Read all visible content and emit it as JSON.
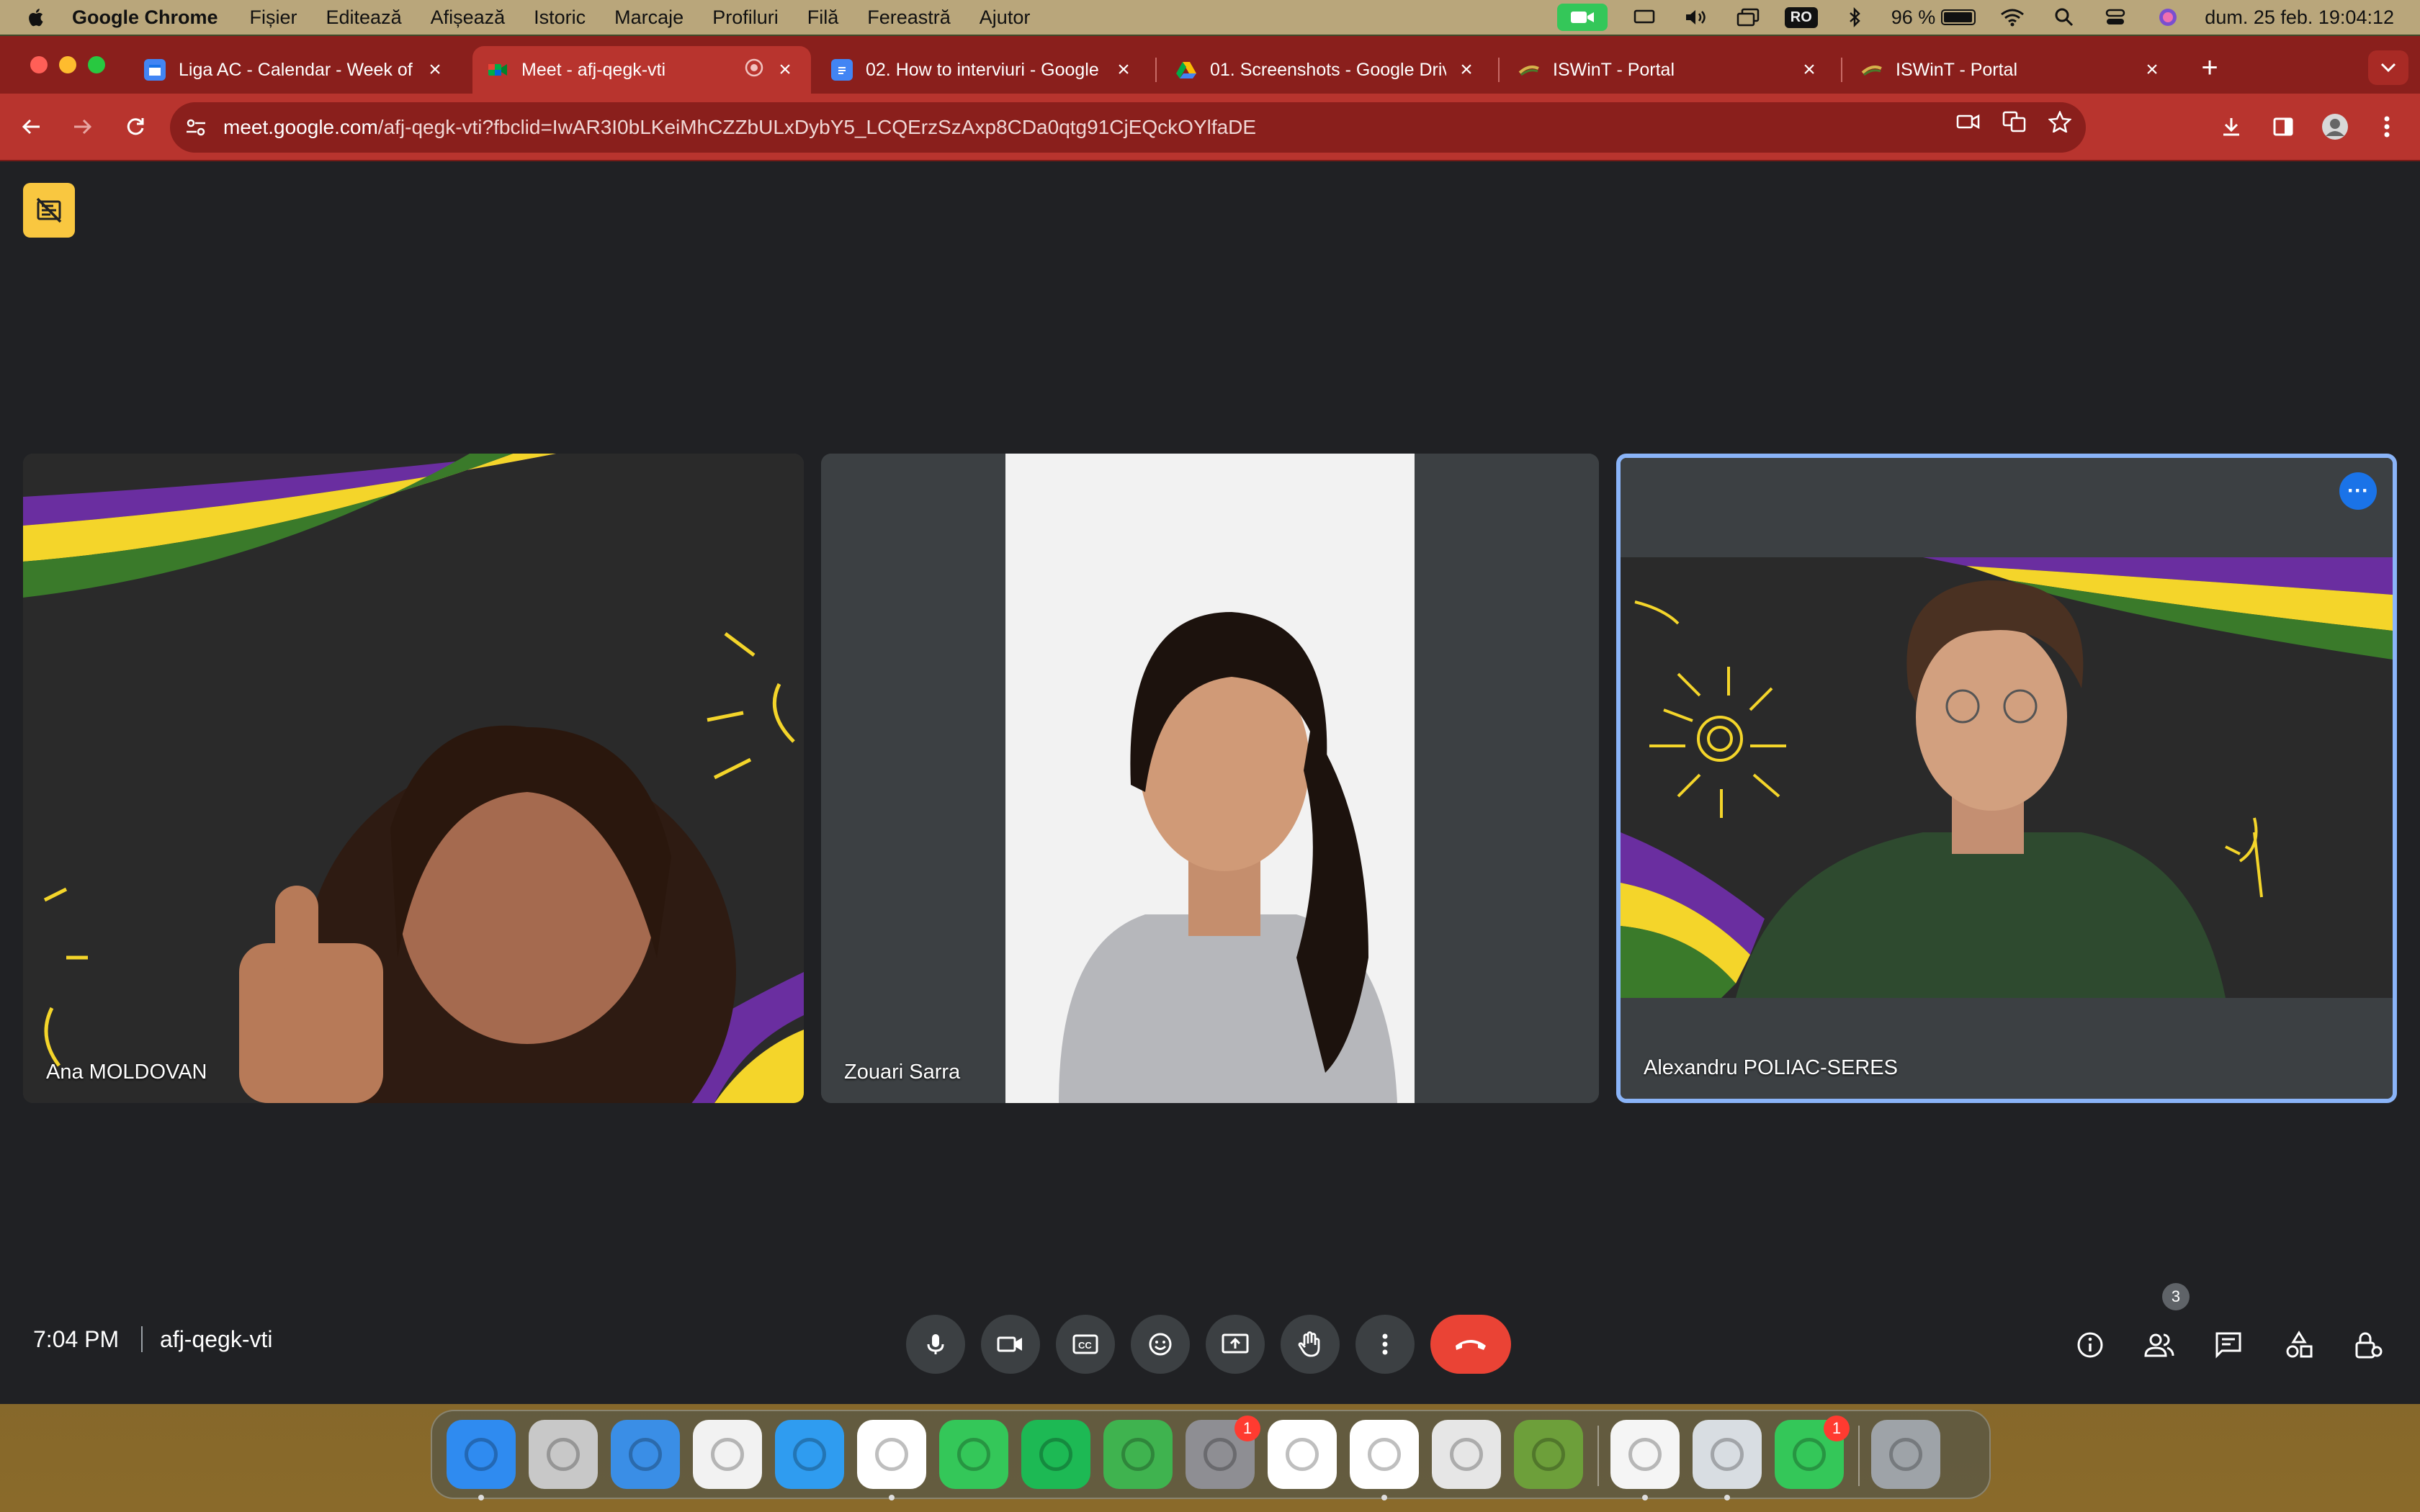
{
  "menubar": {
    "app_name": "Google Chrome",
    "menus": [
      "Fișier",
      "Editează",
      "Afișează",
      "Istoric",
      "Marcaje",
      "Profiluri",
      "Filă",
      "Fereastră",
      "Ajutor"
    ],
    "input_source": "RO",
    "battery": "96 %",
    "battery_level": 0.96,
    "datetime": "dum. 25 feb. 19:04:12"
  },
  "tabs": [
    {
      "title": "Liga AC - Calendar - Week of",
      "favicon": "calendar-icon",
      "color": "#4285f4"
    },
    {
      "title": "Meet - afj-qegk-vti",
      "favicon": "meet-icon",
      "color": "#00ac47",
      "active": true
    },
    {
      "title": "02. How to interviuri - Google",
      "favicon": "docs-icon",
      "color": "#4285f4"
    },
    {
      "title": "01. Screenshots - Google Driv",
      "favicon": "drive-icon",
      "color": "#fbbc04"
    },
    {
      "title": "ISWinT - Portal",
      "favicon": "iswint-icon",
      "color": "#d4b24a"
    },
    {
      "title": "ISWinT - Portal",
      "favicon": "iswint-icon",
      "color": "#d4b24a"
    }
  ],
  "toolbar": {
    "url_host": "meet.google.com",
    "url_rest": "/afj-qegk-vti?fbclid=IwAR3I0bLKeiMhCZZbULxDybY5_LCQErzSzAxp8CDa0qtg91CjEQckOYlfaDE"
  },
  "participants": [
    {
      "name": "Ana MOLDOVAN"
    },
    {
      "name": "Zouari Sarra"
    },
    {
      "name": "Alexandru POLIAC-SERES",
      "active_speaker": true
    }
  ],
  "meeting": {
    "time": "7:04 PM",
    "code": "afj-qegk-vti",
    "people_count": "3"
  },
  "controls": [
    "microphone-icon",
    "camera-icon",
    "captions-icon",
    "emoji-icon",
    "present-icon",
    "raise-hand-icon",
    "more-options-icon",
    "hang-up-icon"
  ],
  "side_controls": [
    "info-icon",
    "people-icon",
    "chat-icon",
    "activities-icon",
    "host-controls-icon"
  ],
  "dock": [
    {
      "name": "finder",
      "color": "#2f8bf0"
    },
    {
      "name": "launchpad",
      "color": "#c8c8c8"
    },
    {
      "name": "mail",
      "color": "#3a8ee6"
    },
    {
      "name": "app-store-like",
      "color": "#f2f2f2"
    },
    {
      "name": "safari",
      "color": "#2f9cf0"
    },
    {
      "name": "chrome",
      "color": "#ffffff"
    },
    {
      "name": "messages",
      "color": "#34c759"
    },
    {
      "name": "spotify",
      "color": "#1db954"
    },
    {
      "name": "camtasia",
      "color": "#3fb34f"
    },
    {
      "name": "system-settings",
      "color": "#8e8e93",
      "badge": "1"
    },
    {
      "name": "messenger",
      "color": "#ffffff"
    },
    {
      "name": "whatsapp",
      "color": "#ffffff"
    },
    {
      "name": "roblox",
      "color": "#e6e6e6"
    },
    {
      "name": "minecraft",
      "color": "#6d9f3a"
    },
    {
      "name": "textedit",
      "color": "#f5f5f5"
    },
    {
      "name": "preview",
      "color": "#d8dde2"
    },
    {
      "name": "facetime",
      "color": "#34c759",
      "badge": "1"
    },
    {
      "name": "trash",
      "color": "#9ea3a8"
    }
  ]
}
